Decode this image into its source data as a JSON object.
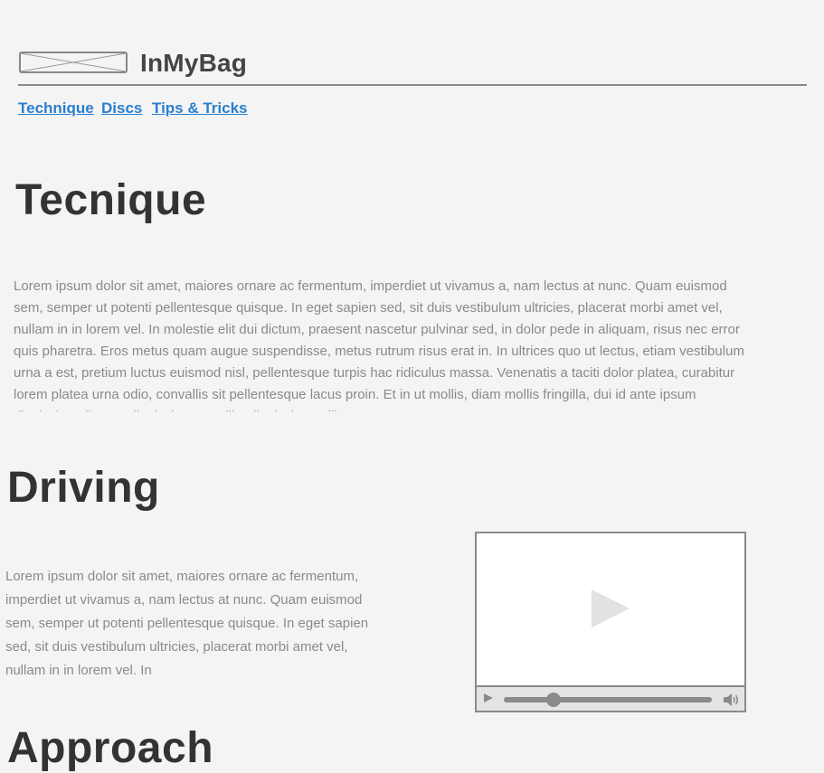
{
  "header": {
    "brand": "InMyBag",
    "logo_icon": "image-placeholder-icon"
  },
  "nav": {
    "items": [
      {
        "label": "Technique"
      },
      {
        "label": "Discs"
      },
      {
        "label": "Tips & Tricks"
      }
    ]
  },
  "sections": {
    "technique": {
      "heading": "Tecnique",
      "body": "Lorem ipsum dolor sit amet, maiores ornare ac fermentum, imperdiet ut vivamus a, nam lectus at nunc. Quam euismod sem, semper ut potenti pellentesque quisque. In eget sapien sed, sit duis vestibulum ultricies, placerat morbi amet vel, nullam in in lorem vel. In molestie elit dui dictum, praesent nascetur pulvinar sed, in dolor pede in aliquam, risus nec error quis pharetra. Eros metus quam augue suspendisse, metus rutrum risus erat in.  In ultrices quo ut lectus, etiam vestibulum urna a est, pretium luctus euismod nisl, pellentesque turpis hac ridiculus massa. Venenatis a taciti dolor platea, curabitur lorem platea urna odio, convallis sit pellentesque lacus proin. Et in ut mollis, diam mollis fringilla, dui id ante ipsum dignissim, aliquam dignissim convallis, dignissim mollis."
    },
    "driving": {
      "heading": "Driving",
      "body": "Lorem ipsum dolor sit amet, maiores ornare ac fermentum, imperdiet ut vivamus a, nam lectus at nunc. Quam euismod sem, semper ut potenti pellentesque quisque. In eget sapien sed, sit duis vestibulum ultricies, placerat morbi amet vel, nullam in in lorem vel. In"
    },
    "approach": {
      "heading": "Approach"
    }
  },
  "video": {
    "play_icon": "play-icon",
    "volume_icon": "volume-icon",
    "progress": 0.24
  },
  "colors": {
    "background": "#f4f4f4",
    "link": "#2a7fcf",
    "heading": "#333333",
    "body_text": "#8a8a8a",
    "placeholder": "#8a8a8a"
  }
}
